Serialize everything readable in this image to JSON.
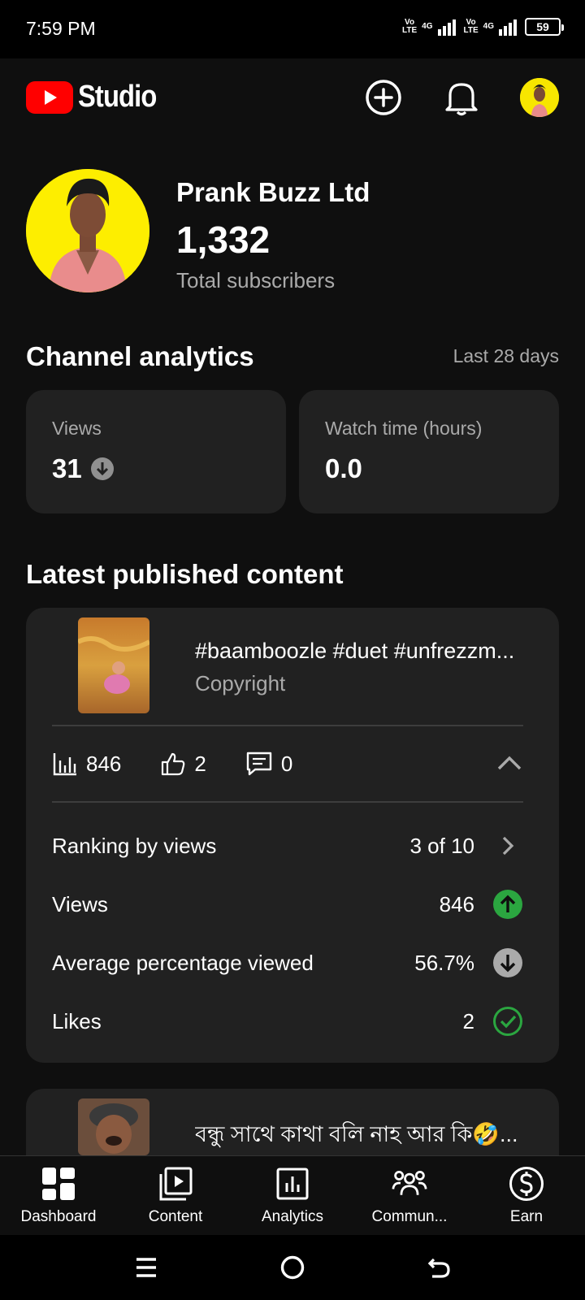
{
  "status_bar": {
    "time": "7:59 PM",
    "sim1": "Vo LTE",
    "sim1_net": "4G",
    "sim2": "Vo LTE",
    "sim2_net": "4G",
    "battery": "59"
  },
  "app_bar": {
    "logo_text": "Studio",
    "icons": [
      "create-icon",
      "notifications-icon",
      "account-avatar"
    ]
  },
  "channel": {
    "name": "Prank Buzz Ltd",
    "subscribers": "1,332",
    "subscribers_label": "Total subscribers"
  },
  "analytics": {
    "title": "Channel analytics",
    "period": "Last 28 days",
    "metrics": [
      {
        "label": "Views",
        "value": "31",
        "trend": "down"
      },
      {
        "label": "Watch time (hours)",
        "value": "0.0"
      }
    ]
  },
  "latest": {
    "title": "Latest published content",
    "items": [
      {
        "title": "#baamboozle #duet #unfrezzm...",
        "subtitle": "Copyright",
        "views": "846",
        "likes": "2",
        "comments": "0",
        "rows": [
          {
            "label": "Ranking by views",
            "value": "3 of 10",
            "icon": "chevron-right-icon"
          },
          {
            "label": "Views",
            "value": "846",
            "icon": "arrow-up-green-icon"
          },
          {
            "label": "Average percentage viewed",
            "value": "56.7%",
            "icon": "arrow-down-gray-icon"
          },
          {
            "label": "Likes",
            "value": "2",
            "icon": "check-circle-green-icon"
          }
        ]
      },
      {
        "title": "বন্ধু সাথে কাথা বলি নাহ আর কি🤣..."
      }
    ]
  },
  "bottom_nav": [
    {
      "label": "Dashboard",
      "icon": "dashboard-icon"
    },
    {
      "label": "Content",
      "icon": "content-icon"
    },
    {
      "label": "Analytics",
      "icon": "analytics-icon"
    },
    {
      "label": "Commun...",
      "icon": "community-icon"
    },
    {
      "label": "Earn",
      "icon": "earn-icon"
    }
  ],
  "colors": {
    "background": "#0f0f0f",
    "card": "#212121",
    "youtube_red": "#ff0000",
    "positive_green": "#2ba640",
    "secondary_text": "#aaaaaa"
  }
}
